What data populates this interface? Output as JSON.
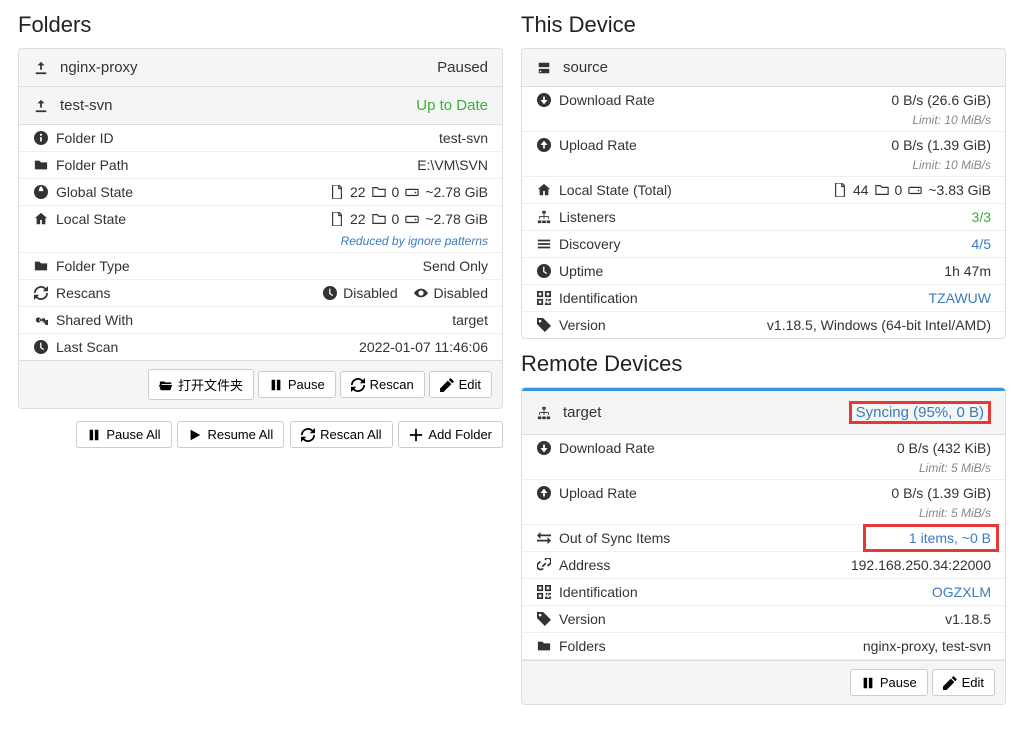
{
  "folders": {
    "heading": "Folders",
    "items": [
      {
        "name": "nginx-proxy",
        "status": "Paused",
        "status_class": ""
      }
    ],
    "expanded": {
      "name": "test-svn",
      "status": "Up to Date",
      "details": {
        "folder_id_label": "Folder ID",
        "folder_id": "test-svn",
        "folder_path_label": "Folder Path",
        "folder_path": "E:\\VM\\SVN",
        "global_state_label": "Global State",
        "global_state_files": "22",
        "global_state_dirs": "0",
        "global_state_size": "~2.78 GiB",
        "local_state_label": "Local State",
        "local_state_files": "22",
        "local_state_dirs": "0",
        "local_state_size": "~2.78 GiB",
        "reduced_note": "Reduced by ignore patterns",
        "folder_type_label": "Folder Type",
        "folder_type": "Send Only",
        "rescans_label": "Rescans",
        "rescans_periodic": "Disabled",
        "rescans_watch": "Disabled",
        "shared_with_label": "Shared With",
        "shared_with": "target",
        "last_scan_label": "Last Scan",
        "last_scan": "2022-01-07 11:46:06"
      },
      "buttons": {
        "open": "打开文件夹",
        "pause": "Pause",
        "rescan": "Rescan",
        "edit": "Edit"
      }
    },
    "bottom_buttons": {
      "pause_all": "Pause All",
      "resume_all": "Resume All",
      "rescan_all": "Rescan All",
      "add_folder": "Add Folder"
    }
  },
  "this_device": {
    "heading": "This Device",
    "name": "source",
    "download_label": "Download Rate",
    "download_value": "0 B/s (26.6 GiB)",
    "download_limit": "Limit: 10 MiB/s",
    "upload_label": "Upload Rate",
    "upload_value": "0 B/s (1.39 GiB)",
    "upload_limit": "Limit: 10 MiB/s",
    "local_state_label": "Local State (Total)",
    "local_state_files": "44",
    "local_state_dirs": "0",
    "local_state_size": "~3.83 GiB",
    "listeners_label": "Listeners",
    "listeners_value": "3/3",
    "discovery_label": "Discovery",
    "discovery_value": "4/5",
    "uptime_label": "Uptime",
    "uptime_value": "1h 47m",
    "identification_label": "Identification",
    "identification_value": "TZAWUW",
    "version_label": "Version",
    "version_value": "v1.18.5, Windows (64-bit Intel/AMD)"
  },
  "remote": {
    "heading": "Remote Devices",
    "name": "target",
    "status": "Syncing (95%, 0 B)",
    "download_label": "Download Rate",
    "download_value": "0 B/s (432 KiB)",
    "download_limit": "Limit: 5 MiB/s",
    "upload_label": "Upload Rate",
    "upload_value": "0 B/s (1.39 GiB)",
    "upload_limit": "Limit: 5 MiB/s",
    "oos_label": "Out of Sync Items",
    "oos_value": "1 items, ~0 B",
    "address_label": "Address",
    "address_value": "192.168.250.34:22000",
    "identification_label": "Identification",
    "identification_value": "OGZXLM",
    "version_label": "Version",
    "version_value": "v1.18.5",
    "folders_label": "Folders",
    "folders_value": "nginx-proxy, test-svn",
    "buttons": {
      "pause": "Pause",
      "edit": "Edit"
    }
  }
}
